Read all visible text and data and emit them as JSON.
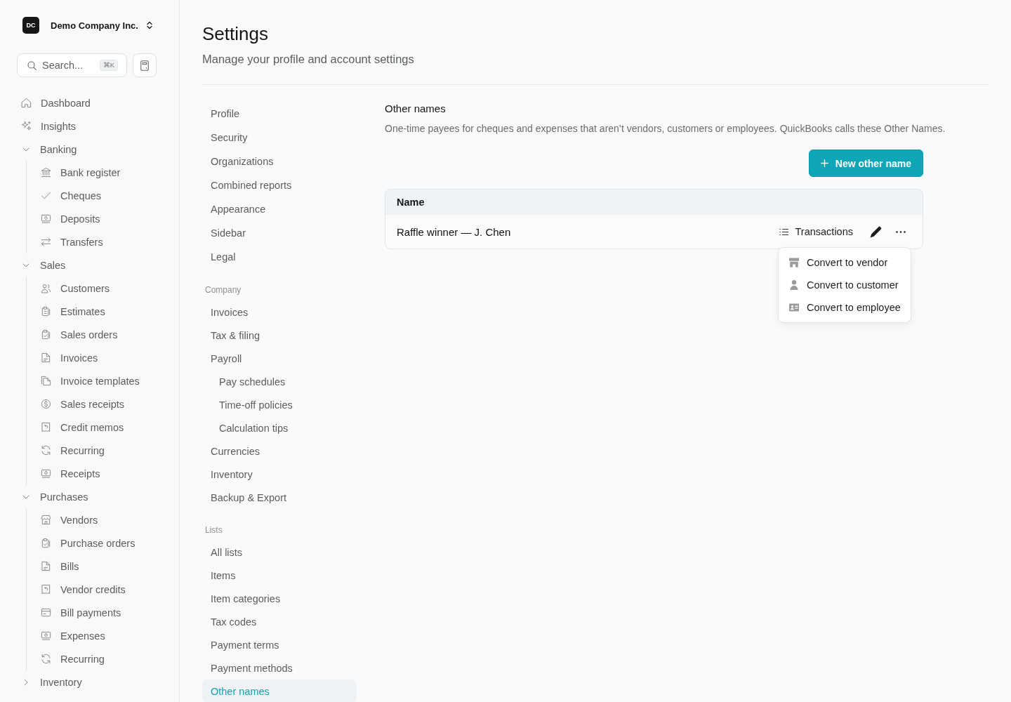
{
  "sidebar": {
    "org": {
      "initials": "DC",
      "name": "Demo Company Inc."
    },
    "search": {
      "placeholder": "Search...",
      "shortcut": "⌘K"
    },
    "items": [
      {
        "label": "Dashboard",
        "kind": "link"
      },
      {
        "label": "Insights",
        "kind": "link"
      },
      {
        "label": "Banking",
        "kind": "group",
        "expanded": true,
        "children": [
          {
            "label": "Bank register"
          },
          {
            "label": "Cheques"
          },
          {
            "label": "Deposits"
          },
          {
            "label": "Transfers"
          }
        ]
      },
      {
        "label": "Sales",
        "kind": "group",
        "expanded": true,
        "children": [
          {
            "label": "Customers"
          },
          {
            "label": "Estimates"
          },
          {
            "label": "Sales orders"
          },
          {
            "label": "Invoices"
          },
          {
            "label": "Invoice templates"
          },
          {
            "label": "Sales receipts"
          },
          {
            "label": "Credit memos"
          },
          {
            "label": "Recurring"
          },
          {
            "label": "Receipts"
          }
        ]
      },
      {
        "label": "Purchases",
        "kind": "group",
        "expanded": true,
        "children": [
          {
            "label": "Vendors"
          },
          {
            "label": "Purchase orders"
          },
          {
            "label": "Bills"
          },
          {
            "label": "Vendor credits"
          },
          {
            "label": "Bill payments"
          },
          {
            "label": "Expenses"
          },
          {
            "label": "Recurring"
          }
        ]
      },
      {
        "label": "Inventory",
        "kind": "group",
        "expanded": false
      }
    ]
  },
  "page": {
    "title": "Settings",
    "subtitle": "Manage your profile and account settings"
  },
  "settings_nav": {
    "sections": [
      {
        "items": [
          {
            "label": "Profile",
            "selected": false
          },
          {
            "label": "Security",
            "selected": false
          },
          {
            "label": "Organizations",
            "selected": false
          },
          {
            "label": "Combined reports",
            "selected": false
          },
          {
            "label": "Appearance",
            "selected": false
          },
          {
            "label": "Sidebar",
            "selected": false
          },
          {
            "label": "Legal",
            "selected": false
          }
        ]
      },
      {
        "heading": "Company",
        "items": [
          {
            "label": "Invoices",
            "selected": false
          },
          {
            "label": "Tax & filing",
            "selected": false
          },
          {
            "label": "Payroll",
            "selected": false,
            "children": [
              {
                "label": "Pay schedules",
                "selected": false
              },
              {
                "label": "Time-off policies",
                "selected": false
              },
              {
                "label": "Calculation tips",
                "selected": false
              }
            ]
          },
          {
            "label": "Currencies",
            "selected": false
          },
          {
            "label": "Inventory",
            "selected": false
          },
          {
            "label": "Backup & Export",
            "selected": false
          }
        ]
      },
      {
        "heading": "Lists",
        "items": [
          {
            "label": "All lists",
            "selected": false
          },
          {
            "label": "Items",
            "selected": false
          },
          {
            "label": "Item categories",
            "selected": false
          },
          {
            "label": "Tax codes",
            "selected": false
          },
          {
            "label": "Payment terms",
            "selected": false
          },
          {
            "label": "Payment methods",
            "selected": false
          },
          {
            "label": "Other names",
            "selected": true
          }
        ]
      }
    ]
  },
  "panel": {
    "title": "Other names",
    "description": "One-time payees for cheques and expenses that aren’t vendors, customers or employees. QuickBooks calls these Other Names.",
    "new_button": "New other name",
    "table": {
      "columns": [
        "Name"
      ],
      "rows": [
        {
          "name": "Raffle winner — J. Chen",
          "transactions": "Transactions",
          "menu": {
            "open": true,
            "items": [
              {
                "label": "Convert to vendor"
              },
              {
                "label": "Convert to customer"
              },
              {
                "label": "Convert to employee"
              }
            ]
          }
        }
      ]
    }
  }
}
